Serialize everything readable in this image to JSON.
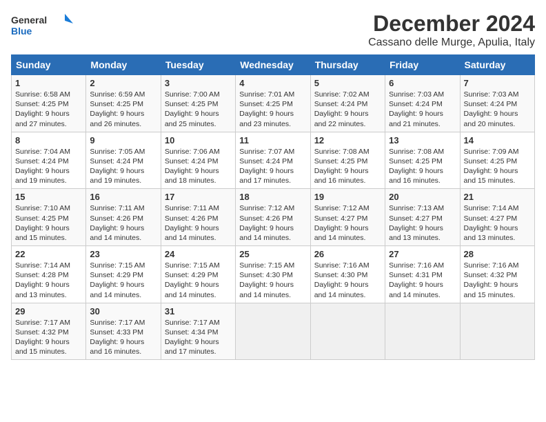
{
  "logo": {
    "line1": "General",
    "line2": "Blue"
  },
  "title": "December 2024",
  "location": "Cassano delle Murge, Apulia, Italy",
  "days_of_week": [
    "Sunday",
    "Monday",
    "Tuesday",
    "Wednesday",
    "Thursday",
    "Friday",
    "Saturday"
  ],
  "weeks": [
    [
      {
        "day": "1",
        "sunrise": "Sunrise: 6:58 AM",
        "sunset": "Sunset: 4:25 PM",
        "daylight": "Daylight: 9 hours and 27 minutes."
      },
      {
        "day": "2",
        "sunrise": "Sunrise: 6:59 AM",
        "sunset": "Sunset: 4:25 PM",
        "daylight": "Daylight: 9 hours and 26 minutes."
      },
      {
        "day": "3",
        "sunrise": "Sunrise: 7:00 AM",
        "sunset": "Sunset: 4:25 PM",
        "daylight": "Daylight: 9 hours and 25 minutes."
      },
      {
        "day": "4",
        "sunrise": "Sunrise: 7:01 AM",
        "sunset": "Sunset: 4:25 PM",
        "daylight": "Daylight: 9 hours and 23 minutes."
      },
      {
        "day": "5",
        "sunrise": "Sunrise: 7:02 AM",
        "sunset": "Sunset: 4:24 PM",
        "daylight": "Daylight: 9 hours and 22 minutes."
      },
      {
        "day": "6",
        "sunrise": "Sunrise: 7:03 AM",
        "sunset": "Sunset: 4:24 PM",
        "daylight": "Daylight: 9 hours and 21 minutes."
      },
      {
        "day": "7",
        "sunrise": "Sunrise: 7:03 AM",
        "sunset": "Sunset: 4:24 PM",
        "daylight": "Daylight: 9 hours and 20 minutes."
      }
    ],
    [
      {
        "day": "8",
        "sunrise": "Sunrise: 7:04 AM",
        "sunset": "Sunset: 4:24 PM",
        "daylight": "Daylight: 9 hours and 19 minutes."
      },
      {
        "day": "9",
        "sunrise": "Sunrise: 7:05 AM",
        "sunset": "Sunset: 4:24 PM",
        "daylight": "Daylight: 9 hours and 19 minutes."
      },
      {
        "day": "10",
        "sunrise": "Sunrise: 7:06 AM",
        "sunset": "Sunset: 4:24 PM",
        "daylight": "Daylight: 9 hours and 18 minutes."
      },
      {
        "day": "11",
        "sunrise": "Sunrise: 7:07 AM",
        "sunset": "Sunset: 4:24 PM",
        "daylight": "Daylight: 9 hours and 17 minutes."
      },
      {
        "day": "12",
        "sunrise": "Sunrise: 7:08 AM",
        "sunset": "Sunset: 4:25 PM",
        "daylight": "Daylight: 9 hours and 16 minutes."
      },
      {
        "day": "13",
        "sunrise": "Sunrise: 7:08 AM",
        "sunset": "Sunset: 4:25 PM",
        "daylight": "Daylight: 9 hours and 16 minutes."
      },
      {
        "day": "14",
        "sunrise": "Sunrise: 7:09 AM",
        "sunset": "Sunset: 4:25 PM",
        "daylight": "Daylight: 9 hours and 15 minutes."
      }
    ],
    [
      {
        "day": "15",
        "sunrise": "Sunrise: 7:10 AM",
        "sunset": "Sunset: 4:25 PM",
        "daylight": "Daylight: 9 hours and 15 minutes."
      },
      {
        "day": "16",
        "sunrise": "Sunrise: 7:11 AM",
        "sunset": "Sunset: 4:26 PM",
        "daylight": "Daylight: 9 hours and 14 minutes."
      },
      {
        "day": "17",
        "sunrise": "Sunrise: 7:11 AM",
        "sunset": "Sunset: 4:26 PM",
        "daylight": "Daylight: 9 hours and 14 minutes."
      },
      {
        "day": "18",
        "sunrise": "Sunrise: 7:12 AM",
        "sunset": "Sunset: 4:26 PM",
        "daylight": "Daylight: 9 hours and 14 minutes."
      },
      {
        "day": "19",
        "sunrise": "Sunrise: 7:12 AM",
        "sunset": "Sunset: 4:27 PM",
        "daylight": "Daylight: 9 hours and 14 minutes."
      },
      {
        "day": "20",
        "sunrise": "Sunrise: 7:13 AM",
        "sunset": "Sunset: 4:27 PM",
        "daylight": "Daylight: 9 hours and 13 minutes."
      },
      {
        "day": "21",
        "sunrise": "Sunrise: 7:14 AM",
        "sunset": "Sunset: 4:27 PM",
        "daylight": "Daylight: 9 hours and 13 minutes."
      }
    ],
    [
      {
        "day": "22",
        "sunrise": "Sunrise: 7:14 AM",
        "sunset": "Sunset: 4:28 PM",
        "daylight": "Daylight: 9 hours and 13 minutes."
      },
      {
        "day": "23",
        "sunrise": "Sunrise: 7:15 AM",
        "sunset": "Sunset: 4:29 PM",
        "daylight": "Daylight: 9 hours and 14 minutes."
      },
      {
        "day": "24",
        "sunrise": "Sunrise: 7:15 AM",
        "sunset": "Sunset: 4:29 PM",
        "daylight": "Daylight: 9 hours and 14 minutes."
      },
      {
        "day": "25",
        "sunrise": "Sunrise: 7:15 AM",
        "sunset": "Sunset: 4:30 PM",
        "daylight": "Daylight: 9 hours and 14 minutes."
      },
      {
        "day": "26",
        "sunrise": "Sunrise: 7:16 AM",
        "sunset": "Sunset: 4:30 PM",
        "daylight": "Daylight: 9 hours and 14 minutes."
      },
      {
        "day": "27",
        "sunrise": "Sunrise: 7:16 AM",
        "sunset": "Sunset: 4:31 PM",
        "daylight": "Daylight: 9 hours and 14 minutes."
      },
      {
        "day": "28",
        "sunrise": "Sunrise: 7:16 AM",
        "sunset": "Sunset: 4:32 PM",
        "daylight": "Daylight: 9 hours and 15 minutes."
      }
    ],
    [
      {
        "day": "29",
        "sunrise": "Sunrise: 7:17 AM",
        "sunset": "Sunset: 4:32 PM",
        "daylight": "Daylight: 9 hours and 15 minutes."
      },
      {
        "day": "30",
        "sunrise": "Sunrise: 7:17 AM",
        "sunset": "Sunset: 4:33 PM",
        "daylight": "Daylight: 9 hours and 16 minutes."
      },
      {
        "day": "31",
        "sunrise": "Sunrise: 7:17 AM",
        "sunset": "Sunset: 4:34 PM",
        "daylight": "Daylight: 9 hours and 17 minutes."
      },
      null,
      null,
      null,
      null
    ]
  ]
}
